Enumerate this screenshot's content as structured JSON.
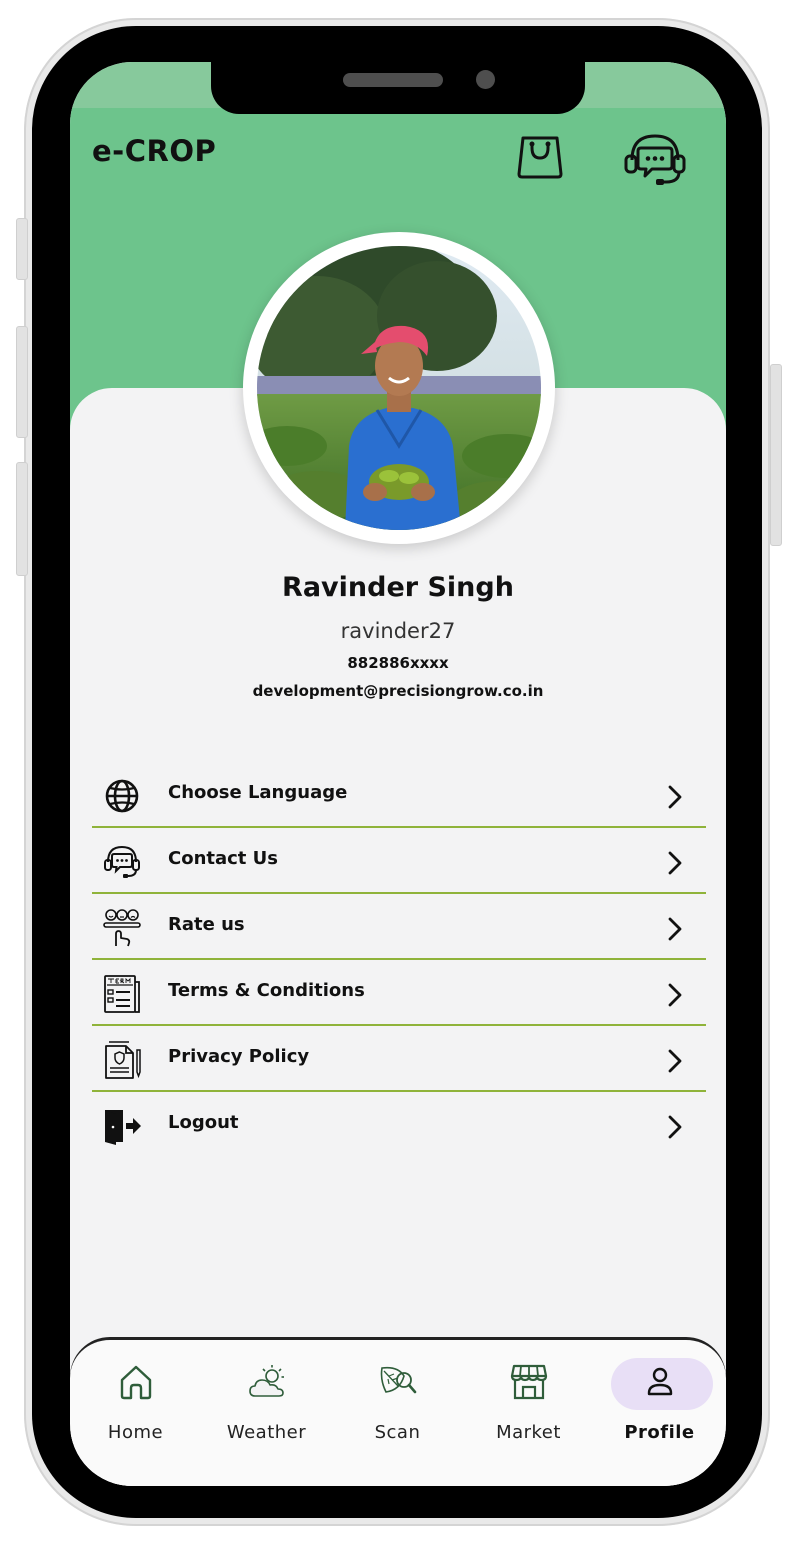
{
  "app": {
    "title": "e-CROP"
  },
  "header_actions": {
    "shop_icon": "shopping-bag-icon",
    "support_icon": "headset-chat-icon"
  },
  "profile": {
    "name": "Ravinder Singh",
    "username": "ravinder27",
    "phone": "882886xxxx",
    "email": "development@precisiongrow.co.in"
  },
  "menu": {
    "items": [
      {
        "label": "Choose Language",
        "icon": "globe-icon"
      },
      {
        "label": "Contact Us",
        "icon": "headset-icon"
      },
      {
        "label": "Rate us",
        "icon": "rating-icon"
      },
      {
        "label": "Terms & Conditions",
        "icon": "terms-icon"
      },
      {
        "label": "Privacy Policy",
        "icon": "privacy-document-icon"
      },
      {
        "label": "Logout",
        "icon": "logout-icon"
      }
    ]
  },
  "tabbar": {
    "tabs": [
      {
        "label": "Home",
        "icon": "home-icon"
      },
      {
        "label": "Weather",
        "icon": "sun-cloud-icon"
      },
      {
        "label": "Scan",
        "icon": "leaf-scan-icon"
      },
      {
        "label": "Market",
        "icon": "storefront-icon"
      },
      {
        "label": "Profile",
        "icon": "person-icon",
        "active": true
      }
    ]
  },
  "colors": {
    "header_green": "#6dc48c",
    "divider_green": "#8fb33a",
    "active_tab_pill": "#e8dff6",
    "icon_dark_green": "#2f5d3a"
  }
}
